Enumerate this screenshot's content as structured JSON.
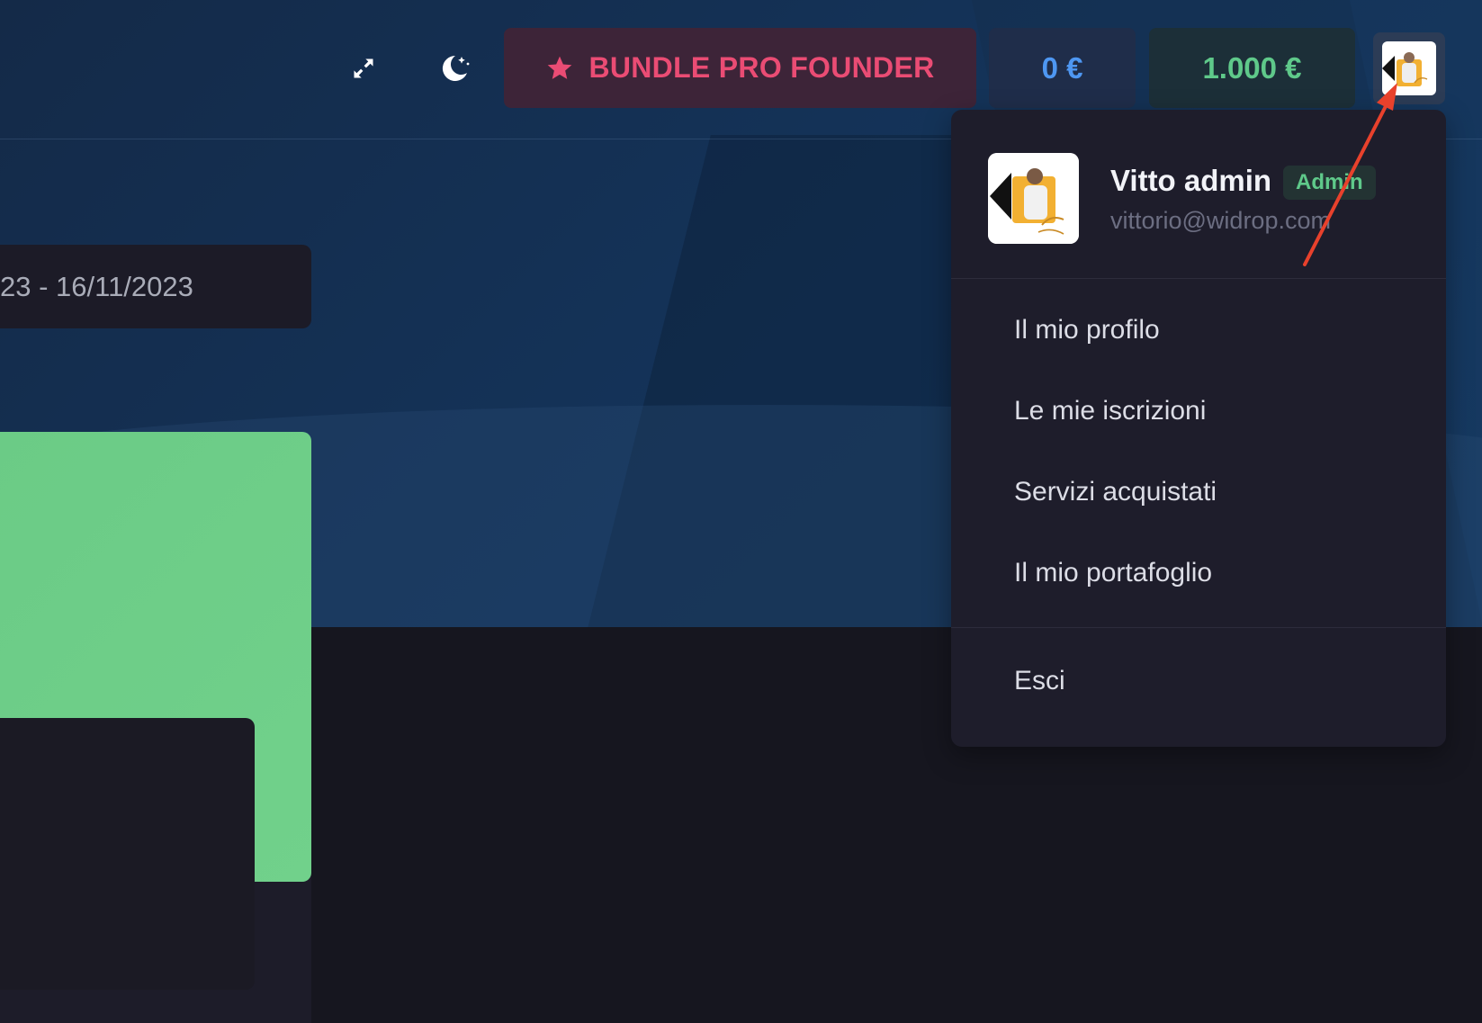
{
  "header": {
    "fullscreen_icon": "expand-arrows-icon",
    "theme_icon": "moon-stars-icon",
    "bundle": {
      "icon": "star-icon",
      "label": "BUNDLE PRO FOUNDER"
    },
    "wallet_balance": "0 €",
    "credit_balance": "1.000 €",
    "avatar_icon": "user-avatar"
  },
  "main": {
    "date_range": "23 - 16/11/2023"
  },
  "user_menu": {
    "name": "Vitto admin",
    "role_badge": "Admin",
    "email": "vittorio@widrop.com",
    "items": [
      {
        "label": "Il mio profilo"
      },
      {
        "label": "Le mie iscrizioni"
      },
      {
        "label": "Servizi acquistati"
      },
      {
        "label": "Il mio portafoglio"
      }
    ],
    "logout": "Esci"
  },
  "colors": {
    "bundle_accent": "#ea4c74",
    "wallet_accent": "#4e97f2",
    "credit_accent": "#5fc98a",
    "annotation_arrow": "#e8412c"
  }
}
